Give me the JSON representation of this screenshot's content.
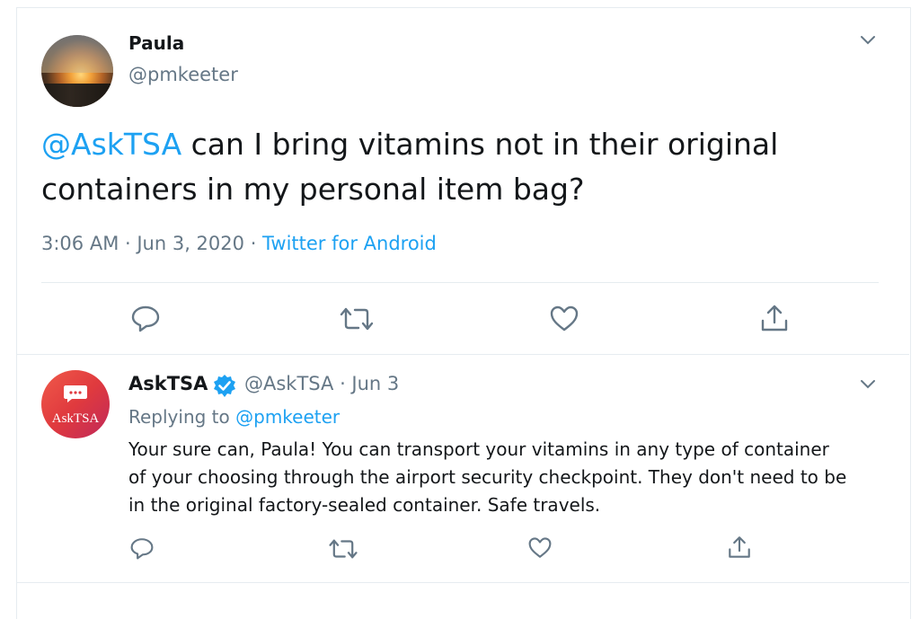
{
  "main_tweet": {
    "name": "Paula",
    "handle": "@pmkeeter",
    "mention": "@AskTSA",
    "text": " can I bring vitamins not in their original containers in my personal item bag?",
    "time": "3:06 AM",
    "date": "Jun 3, 2020",
    "source": "Twitter for Android",
    "sep": " · "
  },
  "reply_tweet": {
    "name": "AskTSA",
    "handle": "@AskTSA",
    "date": "Jun 3",
    "sep": " · ",
    "replying_prefix": "Replying to ",
    "replying_handle": "@pmkeeter",
    "text": "Your sure can, Paula!  You can transport your vitamins in any type of container of your choosing through the airport security checkpoint. They don't need to be in the original factory-sealed container. Safe travels.",
    "avatar_label": "AskTSA"
  },
  "icons": [
    "reply-icon",
    "retweet-icon",
    "like-icon",
    "share-icon",
    "chevron-down-icon",
    "verified-icon"
  ],
  "colors": {
    "accent": "#1da1f2",
    "secondary_text": "#657786",
    "divider": "#e6ecf0",
    "avatar_red": "#e03a3e"
  }
}
